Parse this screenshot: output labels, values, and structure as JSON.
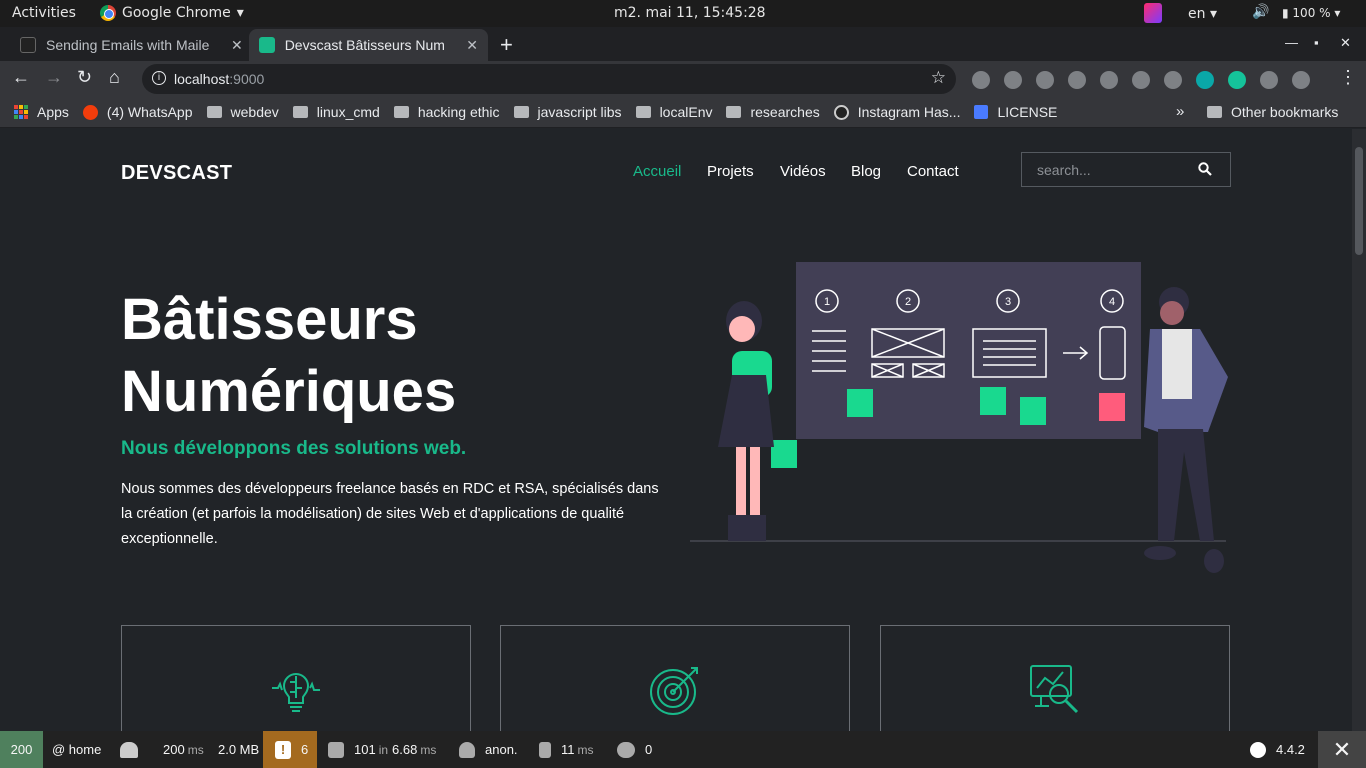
{
  "os": {
    "activities": "Activities",
    "app_name": "Google Chrome",
    "clock": "m2. mai 11, 15:45:28",
    "lang": "en",
    "battery": "100 %"
  },
  "tabs": [
    {
      "title": "Sending Emails with Maile",
      "active": false
    },
    {
      "title": "Devscast Bâtisseurs Num",
      "active": true
    }
  ],
  "omnibox": {
    "host": "localhost",
    "port": ":9000"
  },
  "bookmarks": [
    {
      "label": "Apps",
      "icon": "apps-grid-icon"
    },
    {
      "label": "(4) WhatsApp",
      "icon": "whatsapp-icon"
    },
    {
      "label": "webdev",
      "icon": "folder-icon"
    },
    {
      "label": "linux_cmd",
      "icon": "folder-icon"
    },
    {
      "label": "hacking ethic",
      "icon": "folder-icon"
    },
    {
      "label": "javascript libs",
      "icon": "folder-icon"
    },
    {
      "label": "localEnv",
      "icon": "folder-icon"
    },
    {
      "label": "researches",
      "icon": "folder-icon"
    },
    {
      "label": "Instagram Has...",
      "icon": "instagram-icon"
    },
    {
      "label": "LICENSE",
      "icon": "document-icon"
    }
  ],
  "bookmarks_more": "»",
  "bookmarks_other": "Other bookmarks",
  "site": {
    "brand": "DEVSCAST",
    "nav": [
      "Accueil",
      "Projets",
      "Vidéos",
      "Blog",
      "Contact"
    ],
    "search_placeholder": "search...",
    "hero_title_line1": "Bâtisseurs",
    "hero_title_line2": "Numériques",
    "hero_subtitle": "Nous développons des solutions web.",
    "hero_text": "Nous sommes des développeurs freelance basés en RDC et RSA, spécialisés dans la création (et parfois la modélisation) de sites Web et d'applications de qualité exceptionnelle.",
    "steps": [
      "1",
      "2",
      "3",
      "4"
    ],
    "accent_color": "#19b98a",
    "background_color": "#212428"
  },
  "profiler": {
    "status_code": "200",
    "route": "@ home",
    "time": "200",
    "time_unit": "ms",
    "memory": "2.0 MB",
    "warnings": "6",
    "db_queries": "101",
    "db_in": "in",
    "db_time": "6.68",
    "db_unit": "ms",
    "user": "anon.",
    "twig_time": "11",
    "twig_unit": "ms",
    "cache": "0",
    "version": "4.4.2"
  }
}
